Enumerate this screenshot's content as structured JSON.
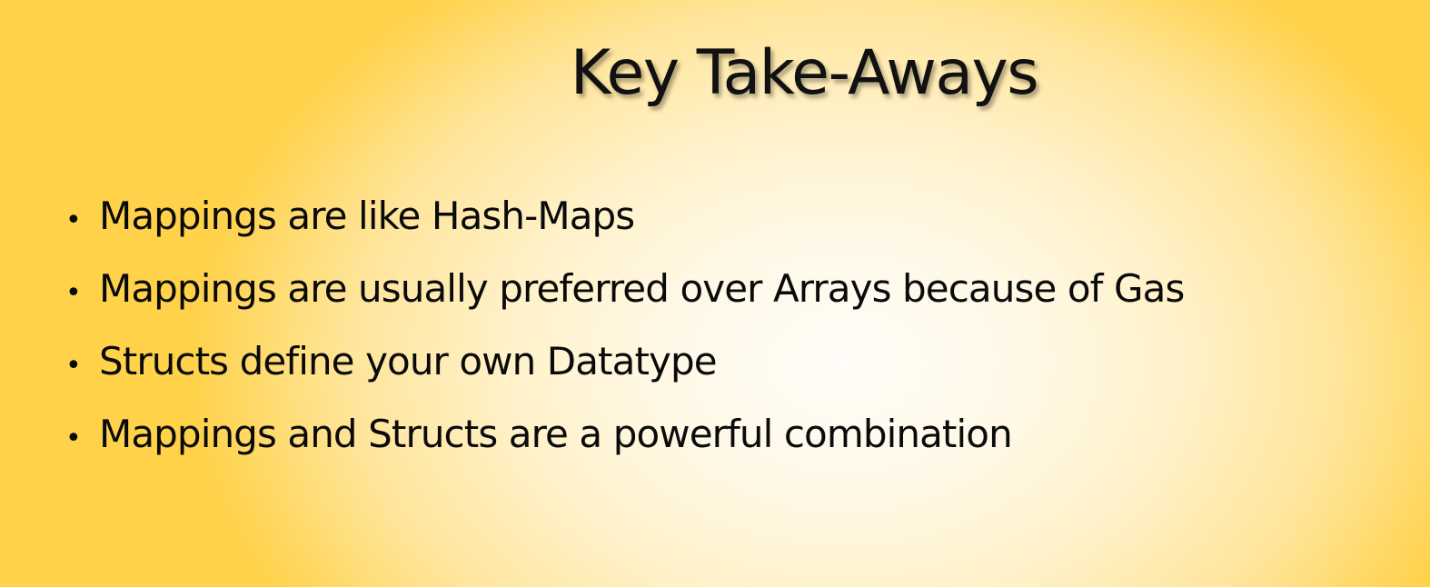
{
  "slide": {
    "title": "Key Take-Aways",
    "bullet_glyph": "•",
    "bullets": [
      "Mappings are like Hash-Maps",
      "Mappings are usually preferred over Arrays because of Gas",
      "Structs define your own Datatype",
      "Mappings and Structs are a powerful combination"
    ]
  },
  "colors": {
    "background_center": "#fffdf8",
    "background_edge": "#ffd24a",
    "text": "#0a0a0a"
  }
}
